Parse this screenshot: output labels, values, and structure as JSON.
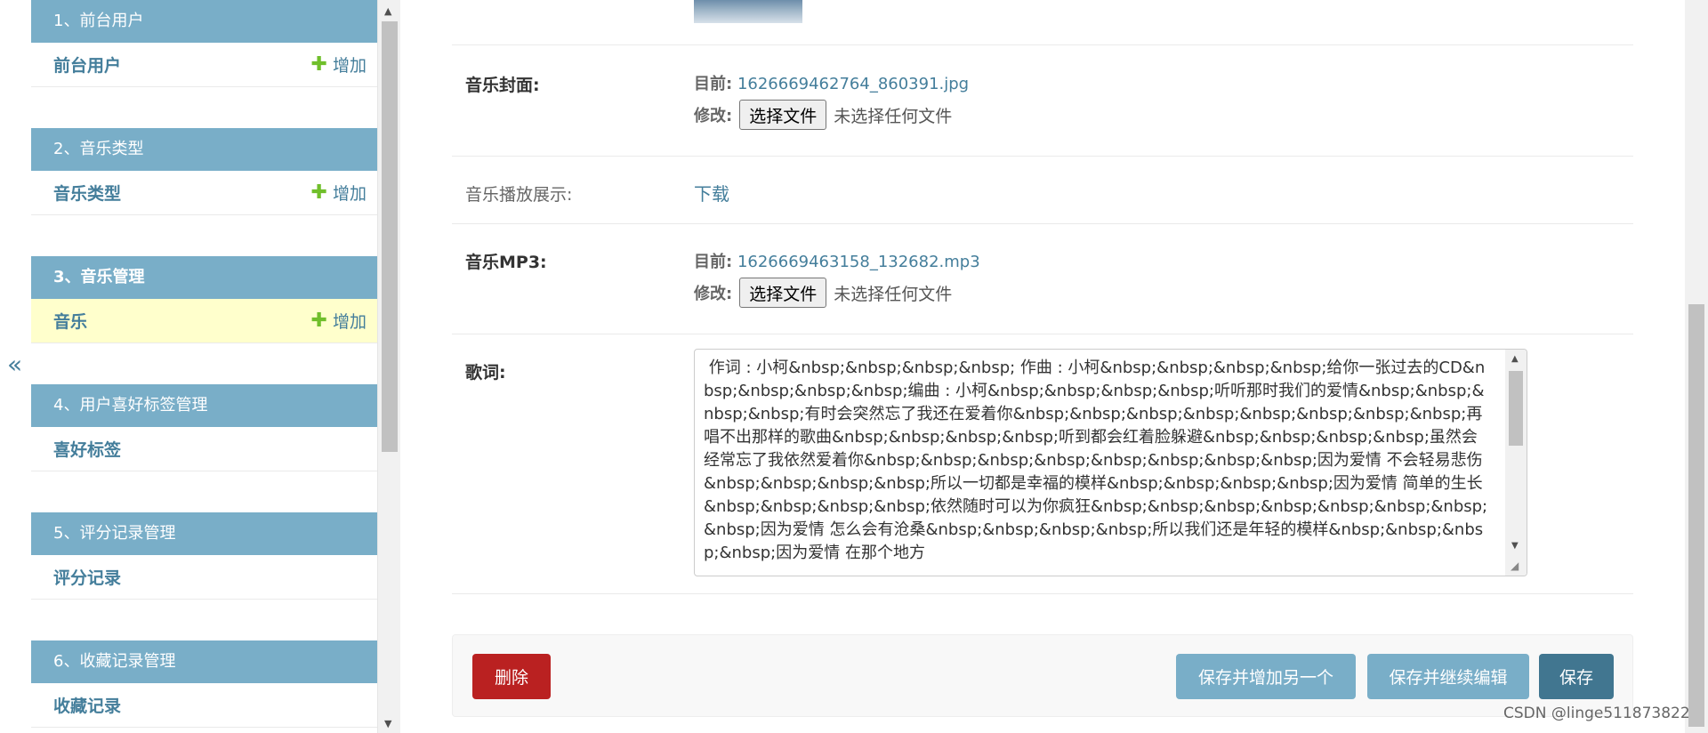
{
  "nav": {
    "collapse_icon": "«",
    "modules": [
      {
        "caption": "1、前台用户",
        "item": "前台用户",
        "add": "增加"
      },
      {
        "caption": "2、音乐类型",
        "item": "音乐类型",
        "add": "增加"
      },
      {
        "caption": "3、音乐管理",
        "item": "音乐",
        "add": "增加"
      },
      {
        "caption": "4、用户喜好标签管理",
        "item": "喜好标签"
      },
      {
        "caption": "5、评分记录管理",
        "item": "评分记录"
      },
      {
        "caption": "6、收藏记录管理",
        "item": "收藏记录"
      }
    ]
  },
  "form": {
    "cover": {
      "label": "音乐封面:",
      "current_label": "目前:",
      "current_file": "1626669462764_860391.jpg",
      "change_label": "修改:",
      "button": "选择文件",
      "none": "未选择任何文件"
    },
    "player": {
      "label": "音乐播放展示:",
      "link": "下载"
    },
    "mp3": {
      "label": "音乐MP3:",
      "current_label": "目前:",
      "current_file": "1626669463158_132682.mp3",
      "change_label": "修改:",
      "button": "选择文件",
      "none": "未选择任何文件"
    },
    "lyrics": {
      "label": "歌词:",
      "text": " 作词 : 小柯&nbsp;&nbsp;&nbsp;&nbsp; 作曲 : 小柯&nbsp;&nbsp;&nbsp;&nbsp;给你一张过去的CD&nbsp;&nbsp;&nbsp;&nbsp;编曲 : 小柯&nbsp;&nbsp;&nbsp;&nbsp;听听那时我们的爱情&nbsp;&nbsp;&nbsp;&nbsp;有时会突然忘了我还在爱着你&nbsp;&nbsp;&nbsp;&nbsp;&nbsp;&nbsp;&nbsp;&nbsp;再唱不出那样的歌曲&nbsp;&nbsp;&nbsp;&nbsp;听到都会红着脸躲避&nbsp;&nbsp;&nbsp;&nbsp;虽然会经常忘了我依然爱着你&nbsp;&nbsp;&nbsp;&nbsp;&nbsp;&nbsp;&nbsp;&nbsp;因为爱情 不会轻易悲伤&nbsp;&nbsp;&nbsp;&nbsp;所以一切都是幸福的模样&nbsp;&nbsp;&nbsp;&nbsp;因为爱情 简单的生长&nbsp;&nbsp;&nbsp;&nbsp;依然随时可以为你疯狂&nbsp;&nbsp;&nbsp;&nbsp;&nbsp;&nbsp;&nbsp;&nbsp;因为爱情 怎么会有沧桑&nbsp;&nbsp;&nbsp;&nbsp;所以我们还是年轻的模样&nbsp;&nbsp;&nbsp;&nbsp;因为爱情 在那个地方"
    }
  },
  "actions": {
    "delete": "删除",
    "save_add_another": "保存并增加另一个",
    "save_continue": "保存并继续编辑",
    "save": "保存"
  },
  "watermark": "CSDN @linge511873822",
  "colors": {
    "module_caption": "#79aec8",
    "link": "#447e9b",
    "add_plus": "#70bf2b",
    "current_row": "#ffffcc",
    "delete": "#ba2121",
    "save": "#417690"
  }
}
